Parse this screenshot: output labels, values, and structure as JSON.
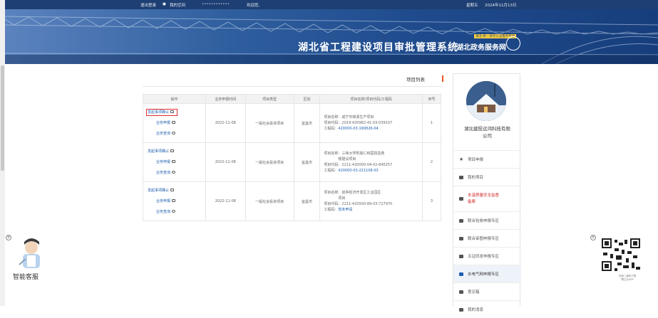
{
  "topbar": {
    "date": "2024年11月13日",
    "weekday": "星期五",
    "welcome": "欢迎您,",
    "username": "••••••••••••",
    "my_space": "我的空间",
    "logout": "退出登录"
  },
  "banner": {
    "system_title": "湖北省工程建设项目审批管理系统",
    "site_name": "湖北政务服务网",
    "site_tag": "湖北·统一身份认证服务平台"
  },
  "content": {
    "tab_label": "项目列表",
    "table": {
      "headers": [
        "序号",
        "项目名称/项目代码/工程码",
        "区划",
        "项目类型",
        "业务申报时间",
        "操作"
      ],
      "rows": [
        {
          "no": "1",
          "name_line1": "项目名称：咸宁市锦源生产项目",
          "name_line2": "项目代码：2019-420962-41-03-039107",
          "name_line3_label": "工程码：",
          "name_line3_code": "420000-03-190826-04",
          "region": "宜昌市",
          "type": "一般社会投资项目",
          "date": "2022-11-08",
          "ops": [
            "发起事项确认",
            "业务申报",
            "业务查询"
          ]
        },
        {
          "no": "2",
          "name_line1": "项目名称：三峡大学附属仁和医院急救",
          "name_line1b": "楼建设项目",
          "name_line2": "项目代码：2211-420000-04-02-840257",
          "name_line3_label": "工程码：",
          "name_line3_code": "420000-03-221108-03",
          "region": "宜昌市",
          "type": "一般社会投资项目",
          "date": "2022-11-08",
          "ops": [
            "发起事项确认",
            "业务申报",
            "业务查询"
          ]
        },
        {
          "no": "3",
          "name_line1": "项目名称：猇亭经济开发区工业园区",
          "name_line1b": "项目",
          "name_line2": "项目代码：2211-420500-89-03-727970",
          "name_line3_label": "工程码：",
          "name_line3_code": "暂未申请",
          "region": "宜昌市",
          "type": "一般社会投资项目",
          "date": "2022-11-08",
          "ops": [
            "发起事项确认",
            "业务申报",
            "业务查询"
          ]
        }
      ]
    }
  },
  "sidebar": {
    "company_name_line1": "湖北建投远鸿科技有限",
    "company_name_line2": "公司",
    "menu": [
      {
        "label": "项目申报",
        "icon": "star-icon"
      },
      {
        "label": "我的项目",
        "icon": "folder-icon"
      },
      {
        "label": "本溪质量安全监督",
        "label2": "备案",
        "icon": "document-icon",
        "red": true
      },
      {
        "label": "联合验收申报专区",
        "icon": "clipboard-icon"
      },
      {
        "label": "联合审图申报专区",
        "icon": "clipboard-icon"
      },
      {
        "label": "五证同发申报专区",
        "icon": "clipboard-icon"
      },
      {
        "label": "水电气网申报专区",
        "icon": "clipboard-icon",
        "active": true
      },
      {
        "label": "意见箱",
        "icon": "mailbox-icon"
      },
      {
        "label": "我的消息",
        "icon": "message-icon"
      }
    ]
  },
  "widgets": {
    "assistant_label": "智能客服",
    "qr_caption_line1": "扫描二维码下载",
    "qr_caption_line2": "鄂汇办APP"
  }
}
